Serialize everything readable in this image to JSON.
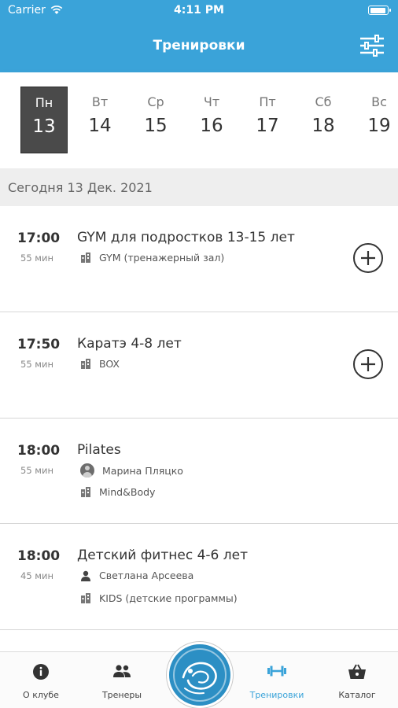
{
  "status_bar": {
    "carrier": "Carrier",
    "time": "4:11 PM"
  },
  "header": {
    "title": "Тренировки"
  },
  "week": [
    {
      "name": "Пн",
      "date": "13",
      "selected": true
    },
    {
      "name": "Вт",
      "date": "14"
    },
    {
      "name": "Ср",
      "date": "15"
    },
    {
      "name": "Чт",
      "date": "16"
    },
    {
      "name": "Пт",
      "date": "17"
    },
    {
      "name": "Сб",
      "date": "18"
    },
    {
      "name": "Вс",
      "date": "19"
    }
  ],
  "date_label": "Сегодня 13 Дек. 2021",
  "sessions": [
    {
      "time": "17:00",
      "duration": "55 мин",
      "title": "GYM  для подростков 13-15 лет",
      "location": "GYM (тренажерный зал)",
      "bookable": true
    },
    {
      "time": "17:50",
      "duration": "55 мин",
      "title": "Каратэ 4-8 лет",
      "location": "BOX",
      "bookable": true
    },
    {
      "time": "18:00",
      "duration": "55 мин",
      "title": "Pilates",
      "trainer": "Марина Пляцко",
      "location": "Mind&Body"
    },
    {
      "time": "18:00",
      "duration": "45 мин",
      "title": "Детский фитнес 4-6 лет",
      "trainer": "Светлана Арсеева",
      "location": "KIDS (детские программы)"
    }
  ],
  "tabs": [
    {
      "label": "О клубе",
      "icon": "info-icon"
    },
    {
      "label": "Тренеры",
      "icon": "people-icon"
    },
    {
      "label": "Тренировки",
      "icon": "dumbbell-icon",
      "active": true
    },
    {
      "label": "Каталог",
      "icon": "basket-icon"
    }
  ],
  "colors": {
    "accent": "#3aa3d9",
    "selected_day": "#4a4a4a",
    "logo": "#2c8fc4"
  }
}
